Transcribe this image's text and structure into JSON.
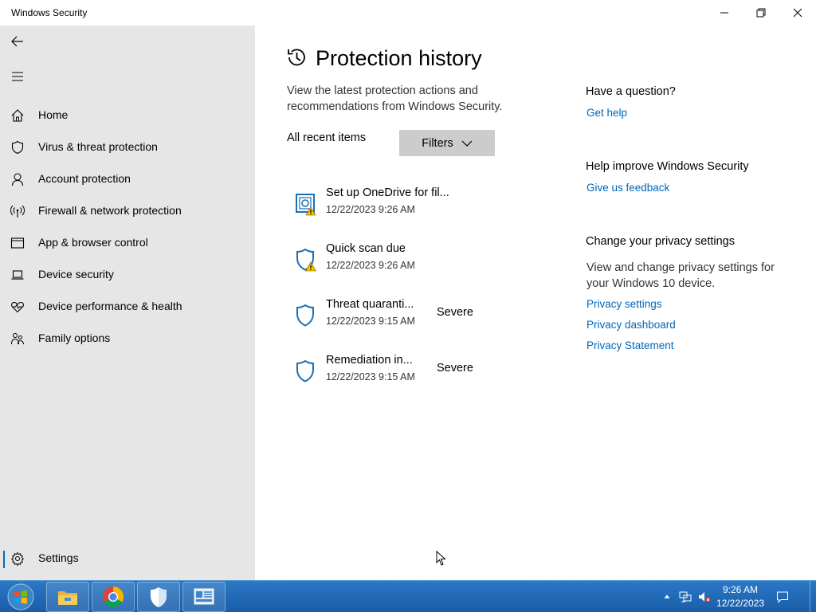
{
  "window": {
    "title": "Windows Security"
  },
  "sidebar": {
    "items": [
      {
        "label": "Home",
        "icon": "home-icon"
      },
      {
        "label": "Virus & threat protection",
        "icon": "shield-icon"
      },
      {
        "label": "Account protection",
        "icon": "person-icon"
      },
      {
        "label": "Firewall & network protection",
        "icon": "antenna-icon"
      },
      {
        "label": "App & browser control",
        "icon": "browser-window-icon"
      },
      {
        "label": "Device security",
        "icon": "laptop-icon"
      },
      {
        "label": "Device performance & health",
        "icon": "heart-pulse-icon"
      },
      {
        "label": "Family options",
        "icon": "family-icon"
      }
    ],
    "settings_label": "Settings"
  },
  "main": {
    "title": "Protection history",
    "description": "View the latest protection actions and recommendations from Windows Security.",
    "recent_label": "All recent items",
    "filters_label": "Filters",
    "history": [
      {
        "title": "Set up OneDrive for fil...",
        "date": "12/22/2023 9:26 AM",
        "severity": ""
      },
      {
        "title": "Quick scan due",
        "date": "12/22/2023 9:26 AM",
        "severity": ""
      },
      {
        "title": "Threat quaranti...",
        "date": "12/22/2023 9:15 AM",
        "severity": "Severe"
      },
      {
        "title": "Remediation in...",
        "date": "12/22/2023 9:15 AM",
        "severity": "Severe"
      }
    ]
  },
  "aside": {
    "question_heading": "Have a question?",
    "get_help": "Get help",
    "improve_heading": "Help improve Windows Security",
    "feedback": "Give us feedback",
    "privacy_heading": "Change your privacy settings",
    "privacy_text": "View and change privacy settings for your Windows 10 device.",
    "privacy_settings": "Privacy settings",
    "privacy_dashboard": "Privacy dashboard",
    "privacy_statement": "Privacy Statement"
  },
  "taskbar": {
    "time": "9:26 AM",
    "date": "12/22/2023"
  },
  "colors": {
    "accent": "#0067b8",
    "sidebar_bg": "#e6e6e6",
    "taskbar": "#1f66b5",
    "warning": "#f5c400"
  }
}
